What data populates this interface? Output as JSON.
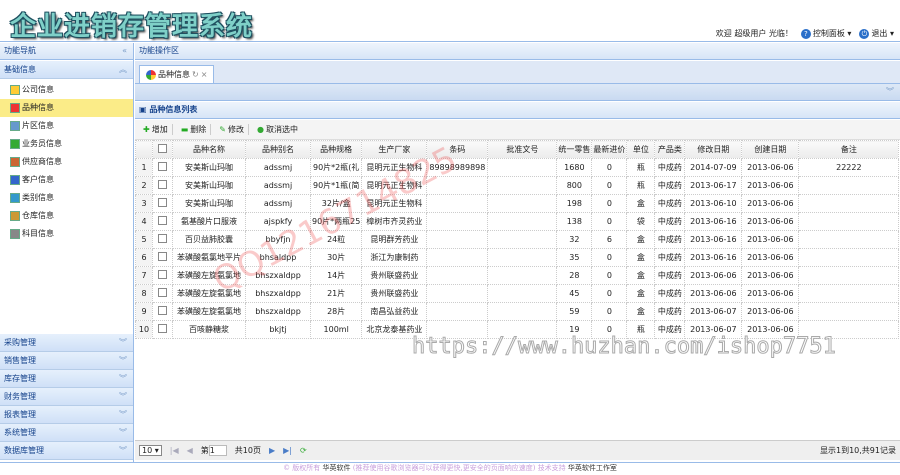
{
  "header": {
    "title": "企业进销存管理系统",
    "welcome": "欢迎 超级用户 光临！",
    "control_panel": "控制面板",
    "logout": "退出"
  },
  "sidebar": {
    "title": "功能导航",
    "section": "基础信息",
    "items": [
      {
        "label": "公司信息"
      },
      {
        "label": "品种信息"
      },
      {
        "label": "片区信息"
      },
      {
        "label": "业务员信息"
      },
      {
        "label": "供应商信息"
      },
      {
        "label": "客户信息"
      },
      {
        "label": "类别信息"
      },
      {
        "label": "仓库信息"
      },
      {
        "label": "科目信息"
      }
    ],
    "groups": [
      {
        "label": "采购管理"
      },
      {
        "label": "销售管理"
      },
      {
        "label": "库存管理"
      },
      {
        "label": "财务管理"
      },
      {
        "label": "报表管理"
      },
      {
        "label": "系统管理"
      },
      {
        "label": "数据库管理"
      }
    ]
  },
  "main": {
    "title": "功能操作区",
    "tab": "品种信息",
    "panel_title": "品种信息列表"
  },
  "toolbar": {
    "add": "增加",
    "delete": "删除",
    "edit": "修改",
    "cancel": "取消选中"
  },
  "table": {
    "columns": [
      "品种名称",
      "品种别名",
      "品种规格",
      "生产厂家",
      "条码",
      "批准文号",
      "统一零售",
      "最新进价",
      "单位",
      "产品类",
      "修改日期",
      "创建日期",
      "备注"
    ],
    "rows": [
      [
        "1",
        "安美斯山玛咖",
        "adssmj",
        "90片*2瓶(礼",
        "昆明元正生物科",
        "89898989898",
        "",
        "1680",
        "0",
        "瓶",
        "中成药",
        "2014-07-09",
        "2013-06-06",
        "22222"
      ],
      [
        "2",
        "安美斯山玛咖",
        "adssmj",
        "90片*1瓶(简",
        "昆明元正生物科",
        "",
        "",
        "800",
        "0",
        "瓶",
        "中成药",
        "2013-06-17",
        "2013-06-06",
        ""
      ],
      [
        "3",
        "安美斯山玛咖",
        "adssmj",
        "32片/盒",
        "昆明元正生物科",
        "",
        "",
        "198",
        "0",
        "盒",
        "中成药",
        "2013-06-10",
        "2013-06-06",
        ""
      ],
      [
        "4",
        "氨基酸片口服液",
        "ajspkfy",
        "90片*两瓶25",
        "樟树市齐灵药业",
        "",
        "",
        "138",
        "0",
        "袋",
        "中成药",
        "2013-06-16",
        "2013-06-06",
        ""
      ],
      [
        "5",
        "百贝益肺胶囊",
        "bbyfjn",
        "24粒",
        "昆明群芳药业",
        "",
        "",
        "32",
        "6",
        "盒",
        "中成药",
        "2013-06-16",
        "2013-06-06",
        ""
      ],
      [
        "6",
        "苯磺酸氨氯地平片",
        "bhsaldpp",
        "30片",
        "浙江为康制药",
        "",
        "",
        "35",
        "0",
        "盒",
        "中成药",
        "2013-06-16",
        "2013-06-06",
        ""
      ],
      [
        "7",
        "苯磺酸左旋氨氯地",
        "bhszxaldpp",
        "14片",
        "贵州联盛药业",
        "",
        "",
        "28",
        "0",
        "盒",
        "中成药",
        "2013-06-06",
        "2013-06-06",
        ""
      ],
      [
        "8",
        "苯磺酸左旋氨氯地",
        "bhszxaldpp",
        "21片",
        "贵州联盛药业",
        "",
        "",
        "45",
        "0",
        "盒",
        "中成药",
        "2013-06-06",
        "2013-06-06",
        ""
      ],
      [
        "9",
        "苯磺酸左旋氨氯地",
        "bhszxaldpp",
        "28片",
        "南昌弘益药业",
        "",
        "",
        "59",
        "0",
        "盒",
        "中成药",
        "2013-06-07",
        "2013-06-06",
        ""
      ],
      [
        "10",
        "百咳静糖浆",
        "bkjtj",
        "100ml",
        "北京龙泰基药业",
        "",
        "",
        "19",
        "0",
        "瓶",
        "中成药",
        "2013-06-07",
        "2013-06-06",
        ""
      ]
    ]
  },
  "pager": {
    "page_size": "10",
    "page_prefix": "第",
    "page": "1",
    "total_pages": "共10页",
    "summary": "显示1到10,共91记录"
  },
  "footer": {
    "copyright": "© 版权所有",
    "company": "华英软件",
    "note": "(推荐使用谷歌浏览器可以获得更快,更安全的页面响应速度)",
    "support": "技术支持",
    "studio": "华英软件工作室"
  },
  "watermarks": {
    "qq": "QQ1216714825",
    "url": "https://www.huzhan.com/ishop7751"
  }
}
